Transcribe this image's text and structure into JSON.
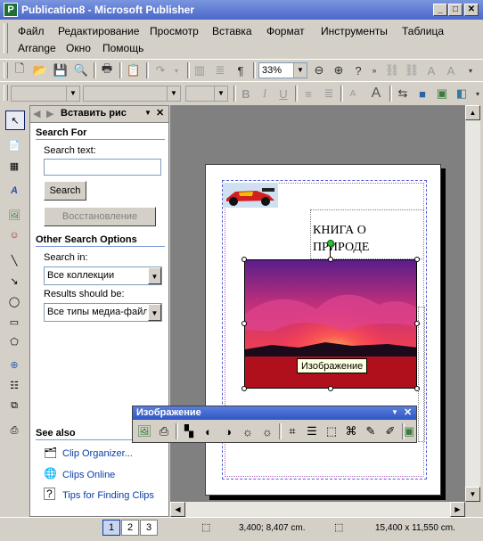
{
  "window": {
    "title": "Publication8 - Microsoft Publisher"
  },
  "menu": {
    "row1": [
      "Файл",
      "Редактирование",
      "Просмотр",
      "Вставка",
      "Формат",
      "Инструменты",
      "Таблица"
    ],
    "row2": [
      "Arrange",
      "Окно",
      "Помощь"
    ]
  },
  "toolbar": {
    "zoom": "33%"
  },
  "pane": {
    "title": "Вставить рис",
    "search_for": "Search For",
    "search_text_label": "Search text:",
    "search_value": "",
    "search_button": "Search",
    "restore_button": "Восстановление",
    "other_options": "Other Search Options",
    "search_in_label": "Search in:",
    "search_in_value": "Все коллекции",
    "results_label": "Results should be:",
    "results_value": "Все типы медиа-файл",
    "see_also": "See also",
    "links": [
      "Clip Organizer...",
      "Clips Online",
      "Tips for Finding Clips"
    ]
  },
  "document": {
    "text_line1": "КНИГА О",
    "text_line2": "ПРИРОДЕ",
    "tooltip": "Изображение"
  },
  "picture_toolbar": {
    "title": "Изображение"
  },
  "status": {
    "pages": [
      "1",
      "2",
      "3"
    ],
    "position": "3,400; 8,407 cm.",
    "size": "15,400 x 11,550 cm."
  },
  "colors": {
    "titlebar": "#4c67c9",
    "selection": "#0a3ea8"
  }
}
